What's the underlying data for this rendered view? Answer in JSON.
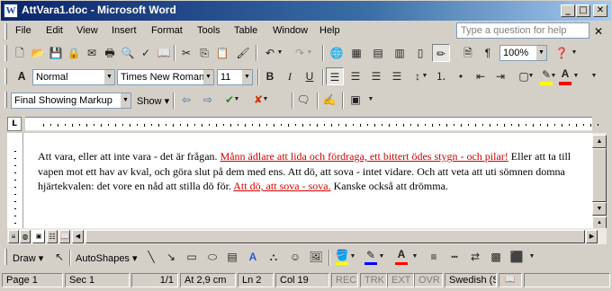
{
  "window": {
    "title": "AttVara1.doc - Microsoft Word",
    "app_icon": "W"
  },
  "menu": [
    "File",
    "Edit",
    "View",
    "Insert",
    "Format",
    "Tools",
    "Table",
    "Window",
    "Help"
  ],
  "help": {
    "placeholder": "Type a question for help"
  },
  "standard_toolbar": {
    "zoom": "100%"
  },
  "formatting_toolbar": {
    "style": "Normal",
    "font": "Times New Roman",
    "size": "11",
    "bold": "B",
    "italic": "I",
    "underline": "U",
    "highlight_color": "#ffff00",
    "font_color": "#ff0000"
  },
  "reviewing_toolbar": {
    "display": "Final Showing Markup",
    "show": "Show"
  },
  "drawing_toolbar": {
    "draw": "Draw",
    "autoshapes": "AutoShapes",
    "line_color": "#0000ff",
    "font_color": "#ff0000"
  },
  "document": {
    "p1": "Att vara, eller att inte vara - det är frågan. ",
    "ins1": "Månn ädlare att lida och fördraga, ett bittert ödes stygn - och pilar!",
    "p2": " Eller att ta till vapen mot ett hav av kval, och göra slut på dem med ens. Att dö, att sova - intet vidare. Och att veta att uti sömnen domna hjärtekvalen: det vore en nåd att stilla dö för. ",
    "ins2": "Att dö, att sova - sova.",
    "p3": " Kanske också att drömma."
  },
  "status": {
    "page": "Page 1",
    "section": "Sec 1",
    "pages": "1/1",
    "at": "At 2,9 cm",
    "line": "Ln 2",
    "col": "Col 19",
    "rec": "REC",
    "trk": "TRK",
    "ext": "EXT",
    "ovr": "OVR",
    "language": "Swedish (S"
  }
}
